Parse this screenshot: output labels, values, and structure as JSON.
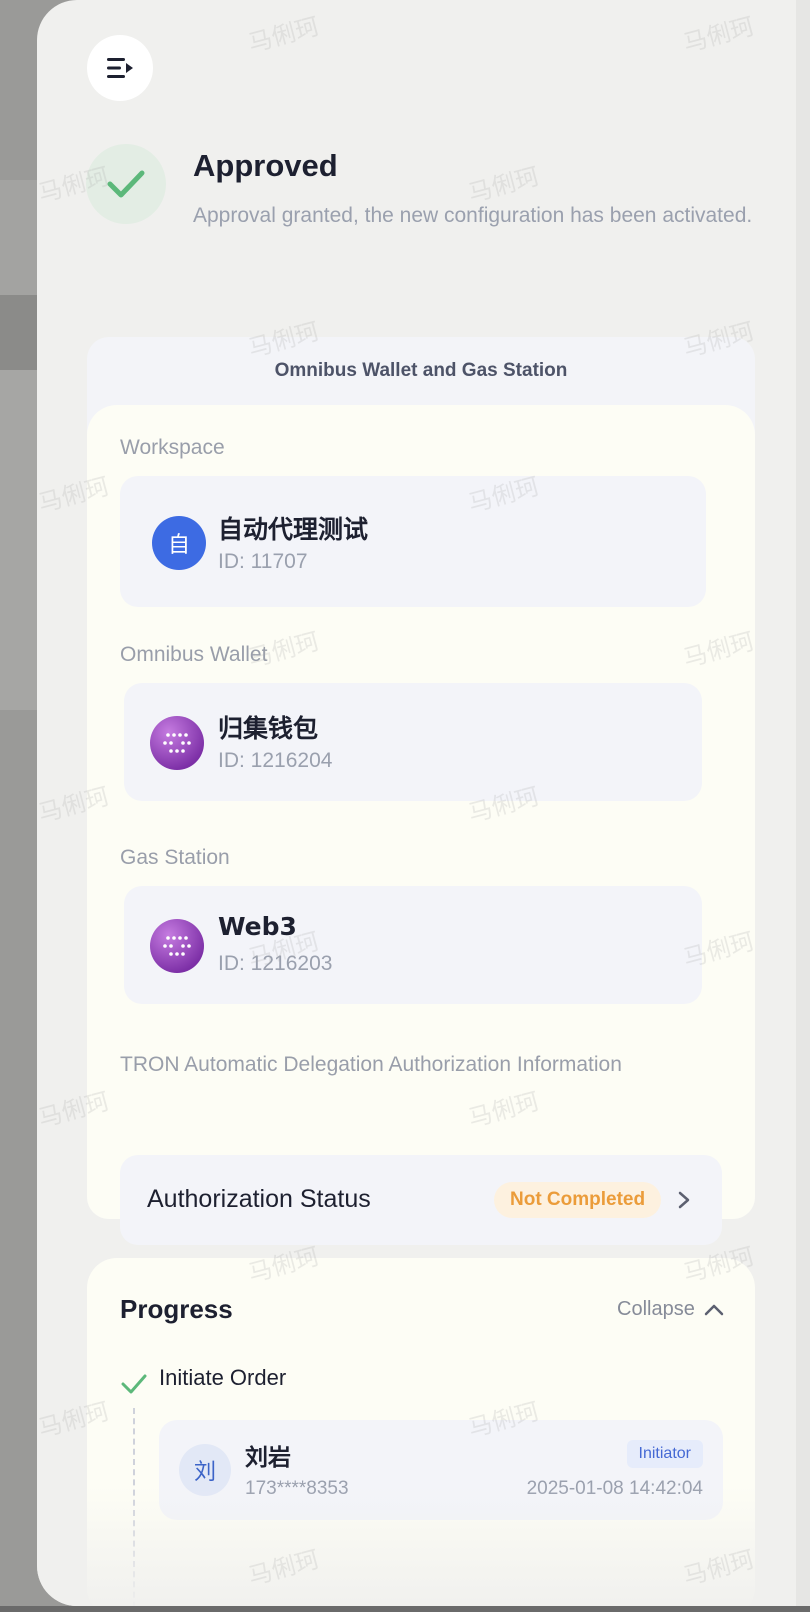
{
  "menu": {
    "icon": "menu-collapse-icon"
  },
  "status": {
    "icon": "check-icon",
    "title": "Approved",
    "description": "Approval granted, the new configuration has been activated."
  },
  "config": {
    "header": "Omnibus Wallet and Gas Station",
    "workspace": {
      "label": "Workspace",
      "avatar": "自",
      "name": "自动代理测试",
      "id": "ID: 11707"
    },
    "omnibus_wallet": {
      "label": "Omnibus Wallet",
      "avatar_icon": "wallet-dots-icon",
      "name": "归集钱包",
      "id": "ID: 1216204"
    },
    "gas_station": {
      "label": "Gas Station",
      "avatar_icon": "wallet-dots-icon",
      "name": "Web3",
      "id": "ID: 1216203"
    },
    "tron": {
      "label": "TRON Automatic Delegation Authorization Information",
      "auth_label": "Authorization Status",
      "auth_status": "Not Completed",
      "status_color": "#eb9c3a"
    }
  },
  "progress": {
    "title": "Progress",
    "collapse_label": "Collapse",
    "steps": [
      {
        "title": "Initiate Order",
        "person": {
          "avatar": "刘",
          "name": "刘岩",
          "phone": "173****8353",
          "role": "Initiator",
          "time": "2025-01-08 14:42:04"
        }
      }
    ]
  },
  "watermark": "马俐珂",
  "colors": {
    "accent": "#3d6be3",
    "success": "#5cb87a",
    "warning": "#eb9c3a"
  }
}
